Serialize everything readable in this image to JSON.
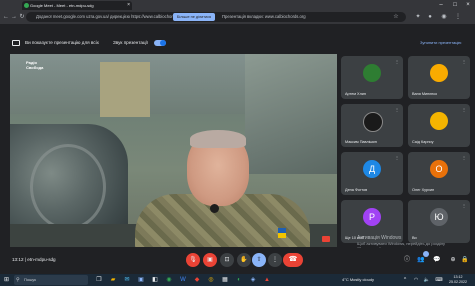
{
  "browser": {
    "tab_title": "Google Meet - Meet - etn-mdpu-sdg",
    "url": "Доданої meet.google.com uzra.gov.ua/ дирекцією https://www.calbiochords.org",
    "share_button_label": "Більше не ділитися",
    "share_message": "Презентація вкладки: www.calbiochords.org"
  },
  "meet": {
    "presenting_text": "Ви показуєте презентацію для всіх",
    "sound_text": "Звук презентації",
    "stop_text": "Зупинити презентацію",
    "video_logo_line1": "Радіо",
    "video_logo_line2": "Свобода",
    "meeting_time": "13:12",
    "meeting_code": "etn-mdpu-sdg",
    "activate_windows_line1": "Активація Windows",
    "activate_windows_line2": "Щоб активувати Windows, перейдіть до розділу",
    "activate_windows_line3": "\"Параметри\".",
    "participants": [
      {
        "name": "Артем Хлип",
        "initial": "",
        "color": "#2e7d32"
      },
      {
        "name": "Ваня Минєнко",
        "initial": "",
        "color": "#f9ab00"
      },
      {
        "name": "Максим Павлішин",
        "initial": "",
        "color": "#1a1a1a"
      },
      {
        "name": "Саід Карпоу",
        "initial": "",
        "color": "#f4b400"
      },
      {
        "name": "Дена Фогтов",
        "initial": "Д",
        "color": "#1e88e5"
      },
      {
        "name": "Олег Хурхин",
        "initial": "О",
        "color": "#e8710a"
      },
      {
        "name": "Ще 10 осіб",
        "initial": "P",
        "color": "#a142f4"
      },
      {
        "name": "Ви",
        "initial": "Ю",
        "color": "#5f6368"
      }
    ]
  },
  "taskbar": {
    "search_placeholder": "Пошук",
    "weather": "4°C  Mostly cloudy",
    "time": "13:12",
    "date": "25.02.2022"
  }
}
